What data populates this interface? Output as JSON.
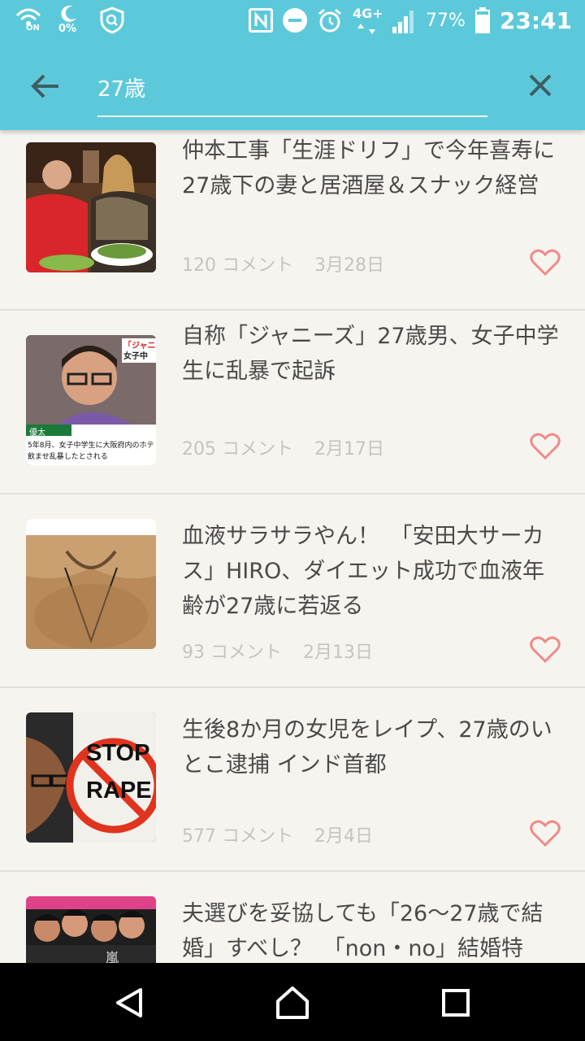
{
  "status_bar": {
    "wifi_label": "ON",
    "data_saver_label": "0%",
    "network": "4G+",
    "battery": "77%",
    "time": "23:41"
  },
  "header": {
    "search_value": "27歳",
    "back_icon": "arrow-left-icon",
    "clear_icon": "close-icon"
  },
  "articles": [
    {
      "title": "仲本工事「生涯ドリフ」で今年喜寿に 27歳下の妻と居酒屋＆スナック経営",
      "comments": "120 コメント",
      "date": "3月28日"
    },
    {
      "title": "自称「ジャニーズ」27歳男、女子中学生に乱暴で起訴",
      "comments": "205 コメント",
      "date": "2月17日"
    },
    {
      "title": "血液サラサラやん！　「安田大サーカス」HIRO、ダイエット成功で血液年齢が27歳に若返る",
      "comments": "93 コメント",
      "date": "2月13日"
    },
    {
      "title": "生後8か月の女児をレイプ、27歳のいとこ逮捕 インド首都",
      "comments": "577 コメント",
      "date": "2月4日"
    },
    {
      "title": "夫選びを妥協しても「26〜27歳で結婚」すべし？　「non・no」結婚特",
      "comments": "",
      "date": ""
    }
  ],
  "thumb_text": {
    "a2_caption1": "「ジャニ",
    "a2_caption2": "女子中",
    "a2_lower1": "優太",
    "a2_lower2": "5年8月、女子中学生に大阪府内のホテ",
    "a2_lower3": "飲ませ乱暴したとされる",
    "a4_sign1": "STOP",
    "a4_sign2": "RAPE",
    "a5_magazine": "嵐"
  },
  "colors": {
    "header": "#5cc9da",
    "heart": "#f08a8a",
    "meta": "#c6c4c0",
    "title": "#4a4a4a",
    "background": "#f6f4ee"
  }
}
